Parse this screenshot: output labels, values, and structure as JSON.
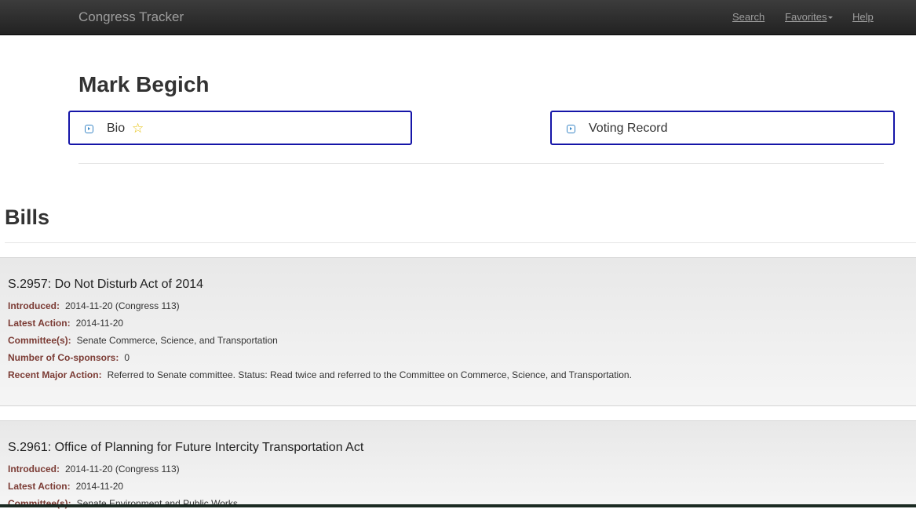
{
  "navbar": {
    "brand": "Congress Tracker",
    "links": {
      "search": "Search",
      "favorites": "Favorites",
      "help": "Help"
    }
  },
  "member": {
    "name": "Mark Begich",
    "panels": {
      "bio": "Bio",
      "voting_record": "Voting Record"
    }
  },
  "bills_section": {
    "heading": "Bills",
    "labels": {
      "introduced": "Introduced:",
      "latest_action": "Latest Action:",
      "committees": "Committee(s):",
      "cosponsors": "Number of Co-sponsors:",
      "recent_major_action": "Recent Major Action:"
    },
    "bills": [
      {
        "title": "S.2957: Do Not Disturb Act of 2014",
        "introduced": "2014-11-20 (Congress 113)",
        "latest_action": "2014-11-20",
        "committees": "Senate Commerce, Science, and Transportation",
        "cosponsors": "0",
        "recent_major_action": "Referred to Senate committee. Status: Read twice and referred to the Committee on Commerce, Science, and Transportation."
      },
      {
        "title": "S.2961: Office of Planning for Future Intercity Transportation Act",
        "introduced": "2014-11-20 (Congress 113)",
        "latest_action": "2014-11-20",
        "committees": "Senate Environment and Public Works"
      }
    ]
  },
  "icons": {
    "panel_icon": "play-circle-icon",
    "favorite_icon": "star-icon"
  },
  "colors": {
    "panel_border": "#1515a8",
    "label_color": "#7b3b34",
    "star": "#e6c210"
  }
}
